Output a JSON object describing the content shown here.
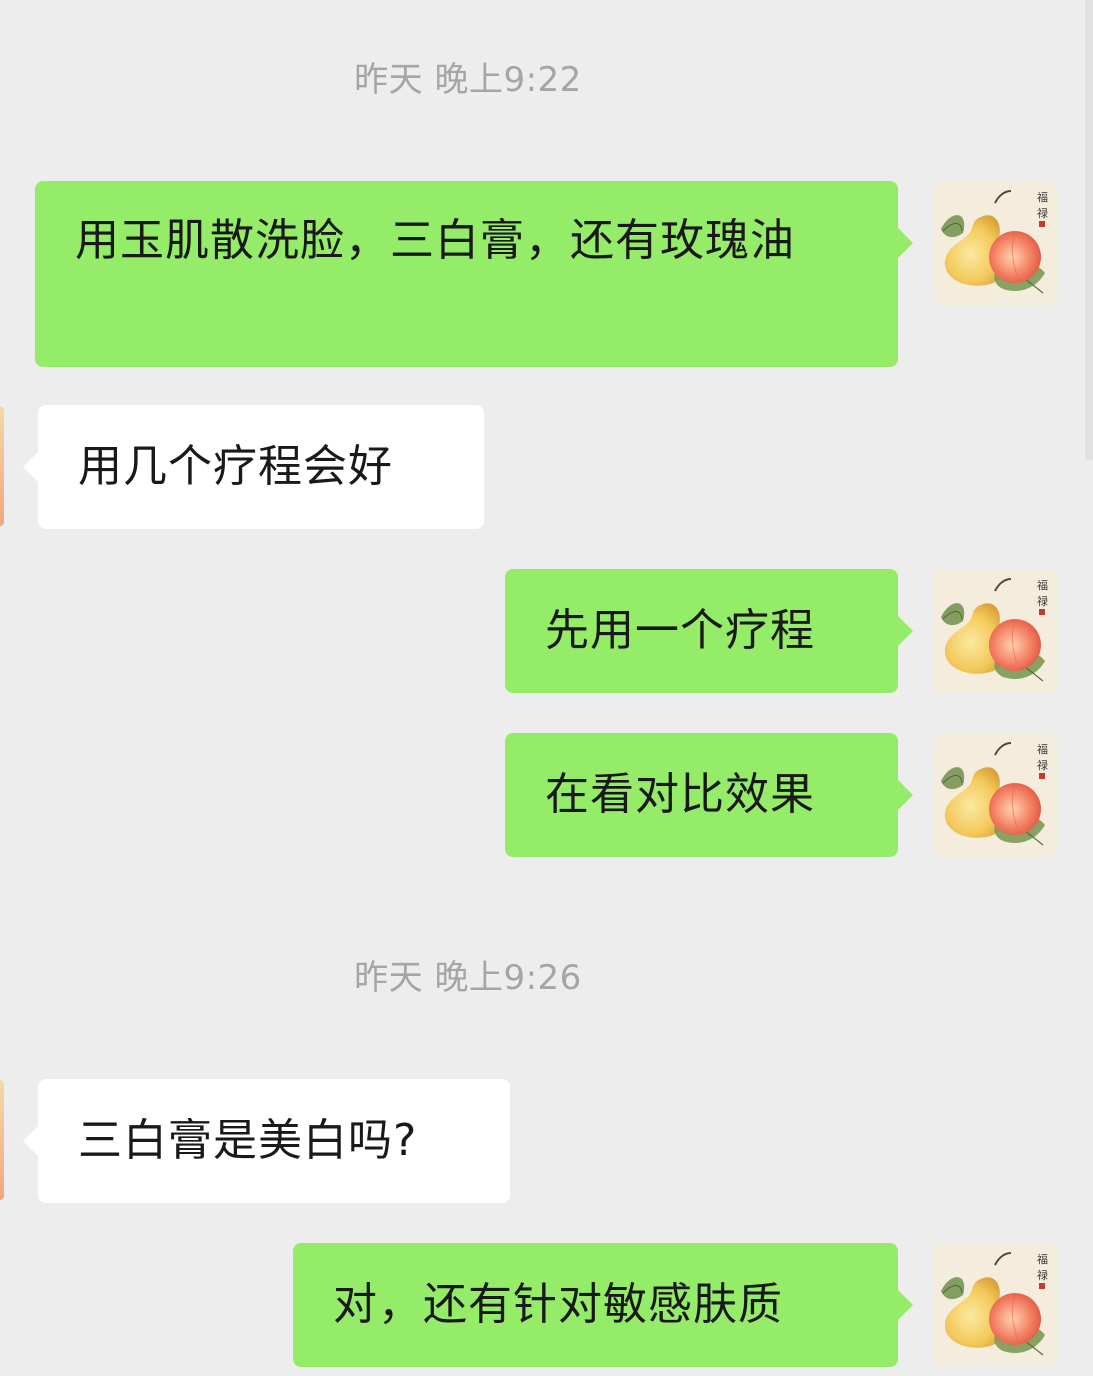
{
  "timestamps": [
    "昨天 晚上9:22",
    "昨天 晚上9:26"
  ],
  "messages": [
    {
      "side": "sent",
      "text": "用玉肌散洗脸，三白膏，还有玫瑰油"
    },
    {
      "side": "received",
      "text": "用几个疗程会好"
    },
    {
      "side": "sent",
      "text": "先用一个疗程"
    },
    {
      "side": "sent",
      "text": "在看对比效果"
    },
    {
      "side": "received",
      "text": "三白膏是美白吗?"
    },
    {
      "side": "sent",
      "text": "对，还有针对敏感肤质"
    }
  ],
  "avatar": {
    "icon": "pear-peach-painting-icon",
    "calligraphy": "福禄"
  },
  "colors": {
    "background": "#ededed",
    "sent_bubble": "#95ec69",
    "received_bubble": "#ffffff",
    "text": "#191919",
    "timestamp": "#a5a5a5"
  }
}
